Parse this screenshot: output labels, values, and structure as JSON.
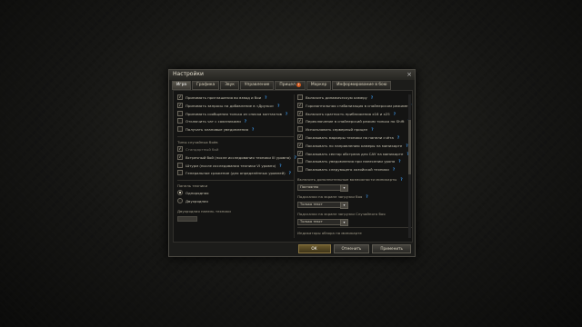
{
  "window": {
    "title": "Настройки",
    "close": "×"
  },
  "tabs": [
    {
      "label": "Игра",
      "active": true
    },
    {
      "label": "Графика"
    },
    {
      "label": "Звук"
    },
    {
      "label": "Управление"
    },
    {
      "label": "Прицел",
      "badge": "1"
    },
    {
      "label": "Маркер"
    },
    {
      "label": "Информирование в бою"
    }
  ],
  "left": {
    "top_items": [
      {
        "label": "Принимать приглашения во взвод и бои",
        "checked": true,
        "help": "?"
      },
      {
        "label": "Принимать запросы на добавление в «Друзья»",
        "checked": true,
        "help": "?"
      },
      {
        "label": "Принимать сообщения только из списка контактов",
        "checked": false,
        "help": "?"
      },
      {
        "label": "Отключить чат с союзниками",
        "checked": false,
        "help": "?"
      },
      {
        "label": "Получать клановые уведомления",
        "checked": false,
        "help": "?"
      }
    ],
    "battle_types_title": "Типы случайных боёв",
    "battle_types": [
      {
        "label": "Стандартный бой",
        "checked": true,
        "dim": true
      },
      {
        "label": "Встречный бой (после исследования техники III уровня)",
        "checked": true,
        "help": "?"
      },
      {
        "label": "Штурм (после исследования техники VI уровня)",
        "checked": false,
        "help": "?"
      },
      {
        "label": "Генеральное сражение (для определённых уровней)",
        "checked": false,
        "help": "?"
      }
    ],
    "carousel_title": "Панель техники",
    "carousel": [
      {
        "label": "Однорядная",
        "selected": true
      },
      {
        "label": "Двухрядная",
        "selected": false
      }
    ],
    "double_carousel_title": "Двухрядная панель техники"
  },
  "right": {
    "items": [
      {
        "label": "Включить динамическую камеру",
        "checked": false,
        "help": "?"
      },
      {
        "label": "Горизонтальная стабилизация в снайперском режиме",
        "checked": true,
        "help": "?"
      },
      {
        "label": "Включить кратность приближения x16 и x25",
        "checked": true,
        "help": "?"
      },
      {
        "label": "Переключение в снайперский режим только по Shift",
        "checked": true,
        "help": "?"
      },
      {
        "label": "Использовать серверный прицел",
        "checked": false,
        "help": "?"
      },
      {
        "label": "Показывать маркеры техники на панели счёта",
        "checked": true,
        "help": "?"
      },
      {
        "label": "Показывать по направлению камеры на миникарте",
        "checked": true,
        "help": "?"
      },
      {
        "label": "Показывать сектор обстрела для САУ на миникарте",
        "checked": true,
        "help": "?"
      },
      {
        "label": "Показывать уведомления при нанесении урона",
        "checked": false,
        "help": "?"
      },
      {
        "label": "Показывать следующего хозяйской техники",
        "checked": false,
        "help": "?"
      }
    ],
    "vehicle_info_title": "Включить дополнительные возможности миникарты",
    "vehicle_info_value": "Постоянно",
    "vehicle_info_help": "?",
    "tooltip_title": "Подсказки на экране загрузки боя",
    "tooltip_value": "Только текст",
    "tooltip_help": "?",
    "random_title": "Подсказки на экране загрузки Случайного боя",
    "random_value": "Только текст",
    "minimap_title": "Индикаторы обзора на миникарте"
  },
  "buttons": {
    "ok": "ОК",
    "cancel": "Отменить",
    "apply": "Применить"
  },
  "colors": {
    "help": "#3a8fdc",
    "badge": "#d45a1e",
    "accent": "#6b5a2d"
  }
}
